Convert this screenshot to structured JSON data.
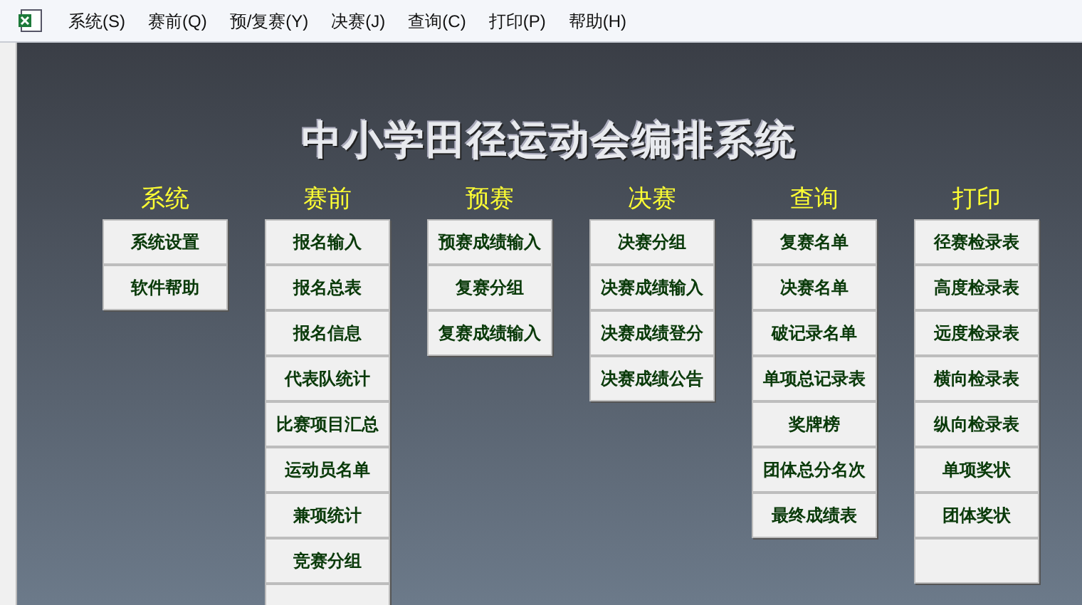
{
  "menu_bar": {
    "items": [
      "系统(S)",
      "赛前(Q)",
      "预/复赛(Y)",
      "决赛(J)",
      "查询(C)",
      "打印(P)",
      "帮助(H)"
    ]
  },
  "title": "中小学田径运动会编排系统",
  "columns": [
    {
      "heading": "系统",
      "buttons": [
        "系统设置",
        "软件帮助"
      ],
      "more_below": false
    },
    {
      "heading": "赛前",
      "buttons": [
        "报名输入",
        "报名总表",
        "报名信息",
        "代表队统计",
        "比赛项目汇总",
        "运动员名单",
        "兼项统计",
        "竞赛分组"
      ],
      "more_below": true
    },
    {
      "heading": "预赛",
      "buttons": [
        "预赛成绩输入",
        "复赛分组",
        "复赛成绩输入"
      ],
      "more_below": false
    },
    {
      "heading": "决赛",
      "buttons": [
        "决赛分组",
        "决赛成绩输入",
        "决赛成绩登分",
        "决赛成绩公告"
      ],
      "more_below": false
    },
    {
      "heading": "查询",
      "buttons": [
        "复赛名单",
        "决赛名单",
        "破记录名单",
        "单项总记录表",
        "奖牌榜",
        "团体总分名次",
        "最终成绩表"
      ],
      "more_below": false
    },
    {
      "heading": "打印",
      "buttons": [
        "径赛检录表",
        "高度检录表",
        "远度检录表",
        "横向检录表",
        "纵向检录表",
        "单项奖状",
        "团体奖状"
      ],
      "more_below": true
    }
  ]
}
